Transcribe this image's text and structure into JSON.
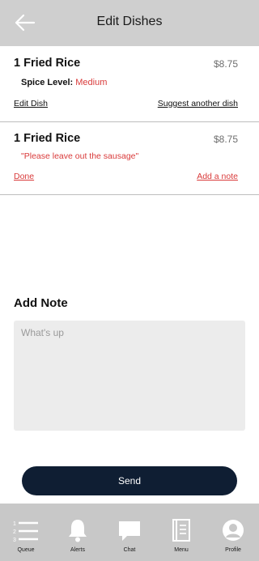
{
  "header": {
    "title": "Edit Dishes",
    "back_icon": "back-arrow-icon"
  },
  "dishes": [
    {
      "name": "1 Fried Rice",
      "price": "$8.75",
      "detail_label": "Spice Level:",
      "detail_value": "Medium",
      "left_action": "Edit Dish",
      "right_action": "Suggest another dish"
    },
    {
      "name": "1 Fried Rice",
      "price": "$8.75",
      "note": "\"Please leave out the sausage\"",
      "left_action": "Done",
      "right_action": "Add a note"
    }
  ],
  "add_note": {
    "title": "Add Note",
    "placeholder": "What's up",
    "value": ""
  },
  "send_label": "Send",
  "tabs": [
    {
      "label": "Queue",
      "icon": "queue-list-icon"
    },
    {
      "label": "Alerts",
      "icon": "bell-icon"
    },
    {
      "label": "Chat",
      "icon": "chat-bubble-icon"
    },
    {
      "label": "Menu",
      "icon": "menu-book-icon"
    },
    {
      "label": "Profile",
      "icon": "profile-avatar-icon"
    }
  ],
  "colors": {
    "accent": "#d93a3a",
    "header_bg": "#cfcfcf",
    "tabbar_bg": "#c8c8c8",
    "send_bg": "#0f1e33",
    "note_bg": "#ececec"
  }
}
